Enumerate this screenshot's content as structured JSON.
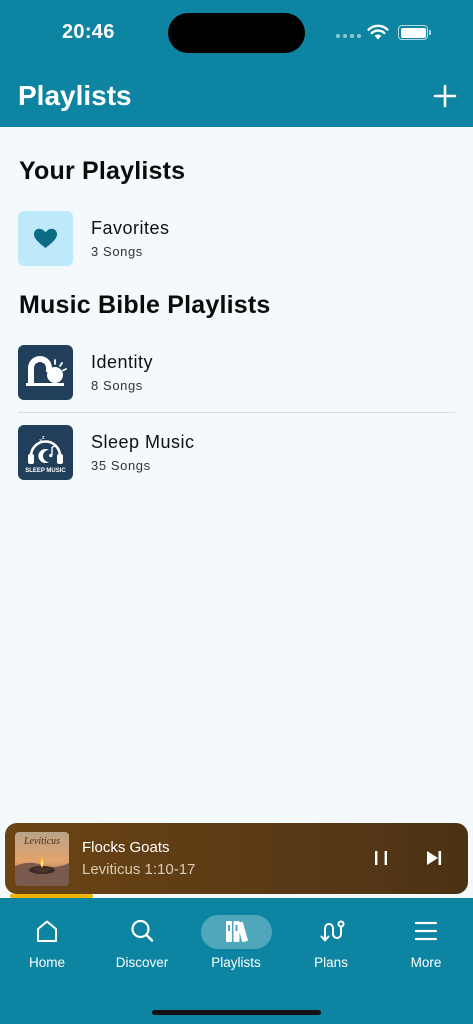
{
  "status_bar": {
    "time": "20:46"
  },
  "header": {
    "title": "Playlists",
    "add_icon": "plus-icon"
  },
  "sections": {
    "your_playlists": {
      "title": "Your Playlists",
      "items": [
        {
          "title": "Favorites",
          "subtitle": "3 Songs",
          "icon": "heart-icon"
        }
      ]
    },
    "music_bible": {
      "title": "Music Bible Playlists",
      "items": [
        {
          "title": "Identity",
          "subtitle": "8 Songs",
          "icon": "identity-sunrise-icon"
        },
        {
          "title": "Sleep Music",
          "subtitle": "35 Songs",
          "icon": "sleep-music-icon",
          "icon_caption": "SLEEP MUSIC"
        }
      ]
    }
  },
  "player": {
    "title": "Flocks Goats",
    "subtitle": "Leviticus 1:10-17",
    "art_caption": "Leviticus",
    "progress_fraction": 0.18
  },
  "tabs": [
    {
      "label": "Home",
      "icon": "home-icon"
    },
    {
      "label": "Discover",
      "icon": "search-icon"
    },
    {
      "label": "Playlists",
      "icon": "library-icon",
      "selected": true
    },
    {
      "label": "Plans",
      "icon": "route-icon"
    },
    {
      "label": "More",
      "icon": "menu-icon"
    }
  ],
  "colors": {
    "primary": "#0d84a1",
    "player_bg": "#5a3a16",
    "progress": "#f0b400",
    "favorite_tile": "#bde9fb",
    "playlist_tile": "#213f5a"
  }
}
